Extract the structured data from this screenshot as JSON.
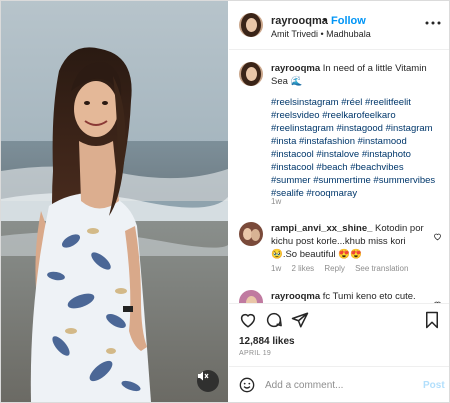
{
  "header": {
    "username": "rayrooqma",
    "separator": "•",
    "follow_label": "Follow",
    "subtitle": "Amit Trivedi • Madhubala",
    "more_label": "•••"
  },
  "caption": {
    "username": "rayrooqma",
    "text": "In need of a little Vitamin Sea 🌊",
    "hashtags": "#reelsinstagram #réel #reelitfeelit #reelsvideo #reelkarofeelkaro #reelinstagram #instagood #instagram #insta #instafashion #instamood #instacool #instalove #instaphoto #instacool #beach #beachvibes #summer #summertime #summervibes #sealife #rooqmaray",
    "time": "1w"
  },
  "comments": [
    {
      "username": "rampi_anvi_xx_shine_",
      "text": "Kotodin por kichu post korle...khub miss kori 🥹.So beautiful 😍😍",
      "time": "1w",
      "likes": "2 likes",
      "reply_label": "Reply",
      "translation_label": "See translation"
    },
    {
      "username": "rayrooqma",
      "text": "fc Tumi keno eto cute."
    }
  ],
  "actions": {
    "likes_count": "12,884 likes",
    "date": "APRIL 19"
  },
  "add_comment": {
    "placeholder": "Add a comment...",
    "post_label": "Post"
  },
  "icons": {
    "mute": "speaker-muted-icon",
    "like": "heart-icon",
    "comment": "comment-bubble-icon",
    "share": "paper-plane-icon",
    "save": "bookmark-icon",
    "emoji": "smiley-icon"
  },
  "colors": {
    "link_blue": "#0095f6",
    "hashtag": "#00376b",
    "muted": "#8e8e8e",
    "post_disabled": "#b2dffc"
  }
}
